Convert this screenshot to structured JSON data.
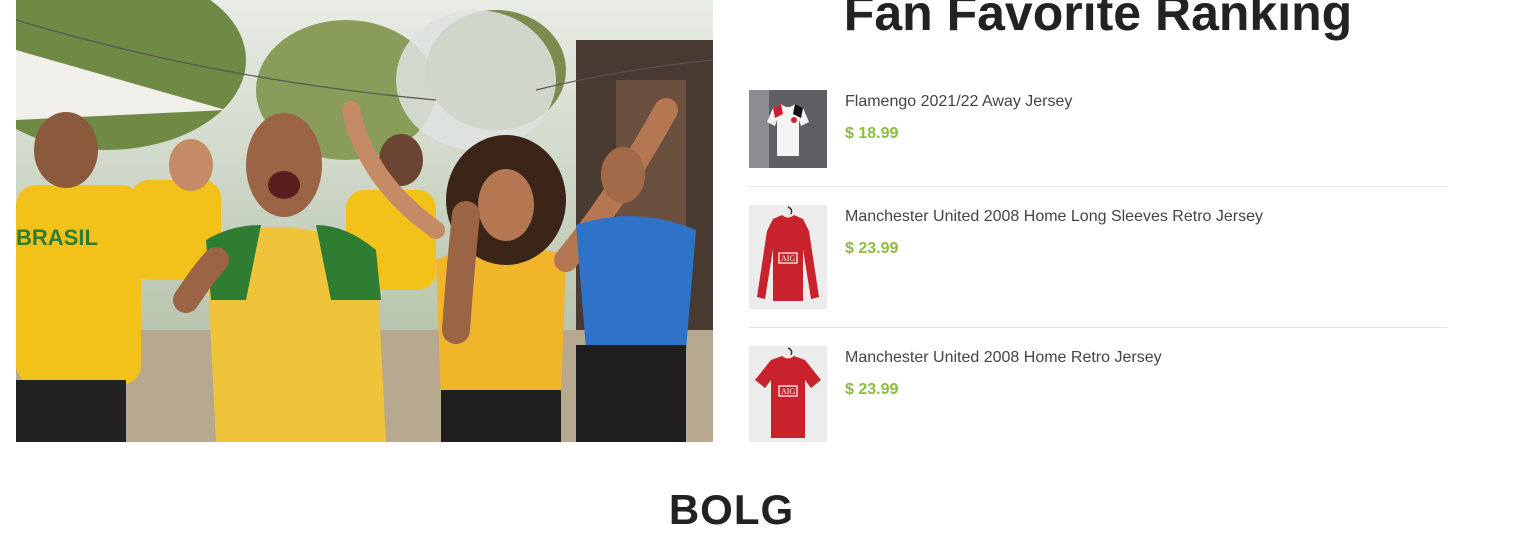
{
  "ranking": {
    "title": "Fan Favorite Ranking",
    "products": [
      {
        "name": "Flamengo 2021/22 Away Jersey",
        "price": "$ 18.99",
        "jersey_color": "#f2f2f2"
      },
      {
        "name": "Manchester United 2008 Home Long Sleeves Retro Jersey",
        "price": "$ 23.99",
        "jersey_color": "#c8232c"
      },
      {
        "name": "Manchester United 2008 Home Retro Jersey",
        "price": "$ 23.99",
        "jersey_color": "#c8232c"
      }
    ]
  },
  "blog": {
    "title": "BOLG"
  },
  "colors": {
    "accent_price": "#8dbd3a",
    "heading": "#222222"
  }
}
